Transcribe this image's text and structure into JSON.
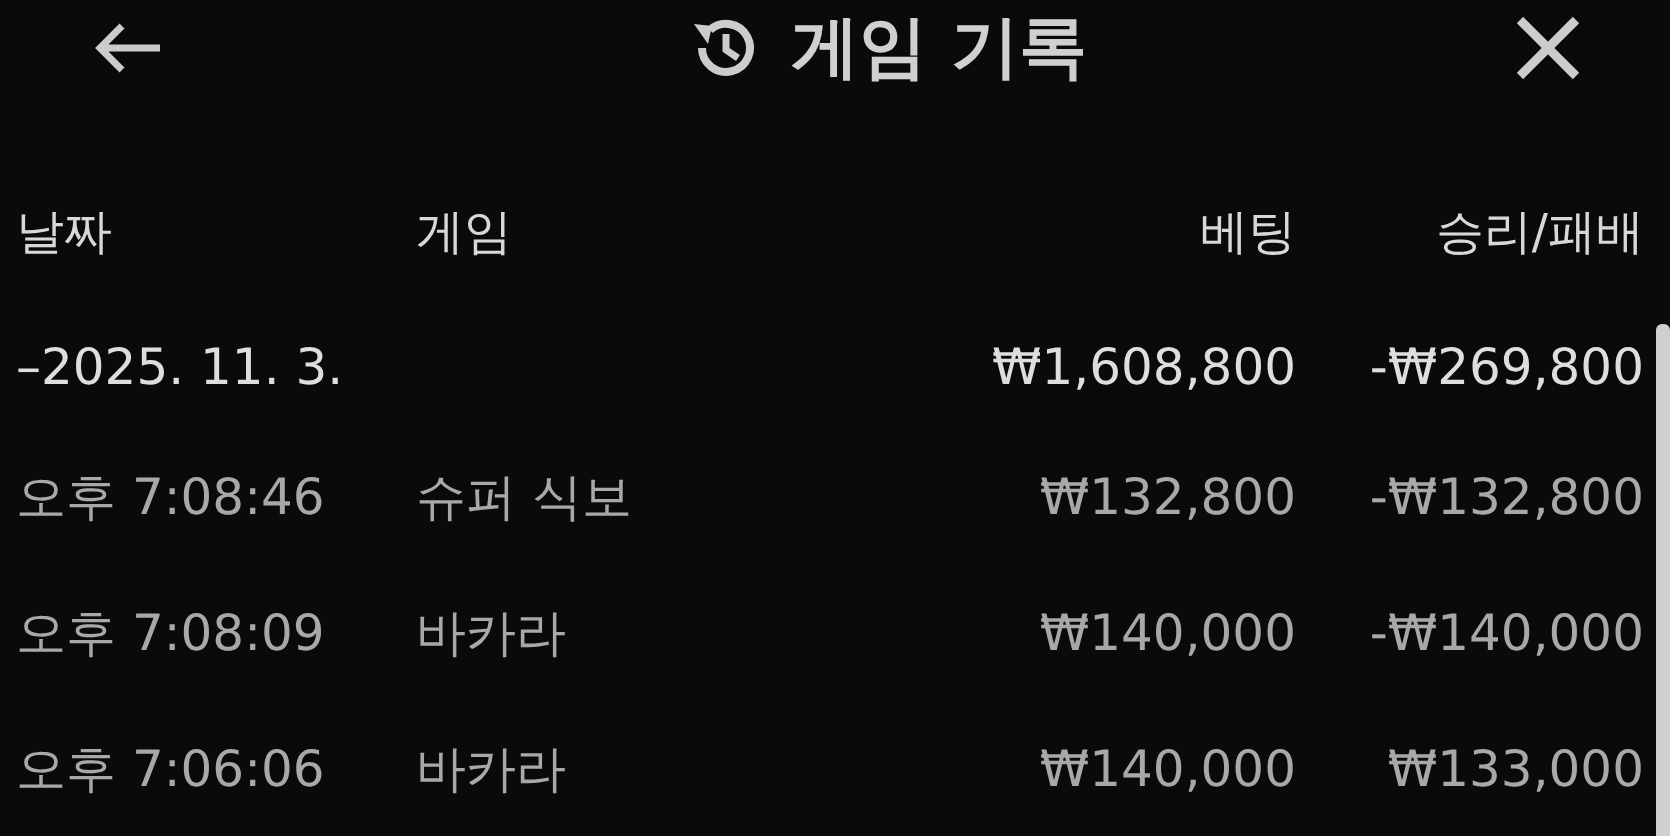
{
  "header": {
    "title": "게임 기록"
  },
  "table": {
    "columns": [
      "날짜",
      "게임",
      "베팅",
      "승리/패배"
    ],
    "group": {
      "date": "–2025. 11. 3.",
      "bet": "₩1,608,800",
      "result": "-₩269,800"
    },
    "rows": [
      {
        "time": "오후 7:08:46",
        "game": "슈퍼 식보",
        "bet": "₩132,800",
        "result": "-₩132,800"
      },
      {
        "time": "오후 7:08:09",
        "game": "바카라",
        "bet": "₩140,000",
        "result": "-₩140,000"
      },
      {
        "time": "오후 7:06:06",
        "game": "바카라",
        "bet": "₩140,000",
        "result": "₩133,000"
      }
    ]
  }
}
